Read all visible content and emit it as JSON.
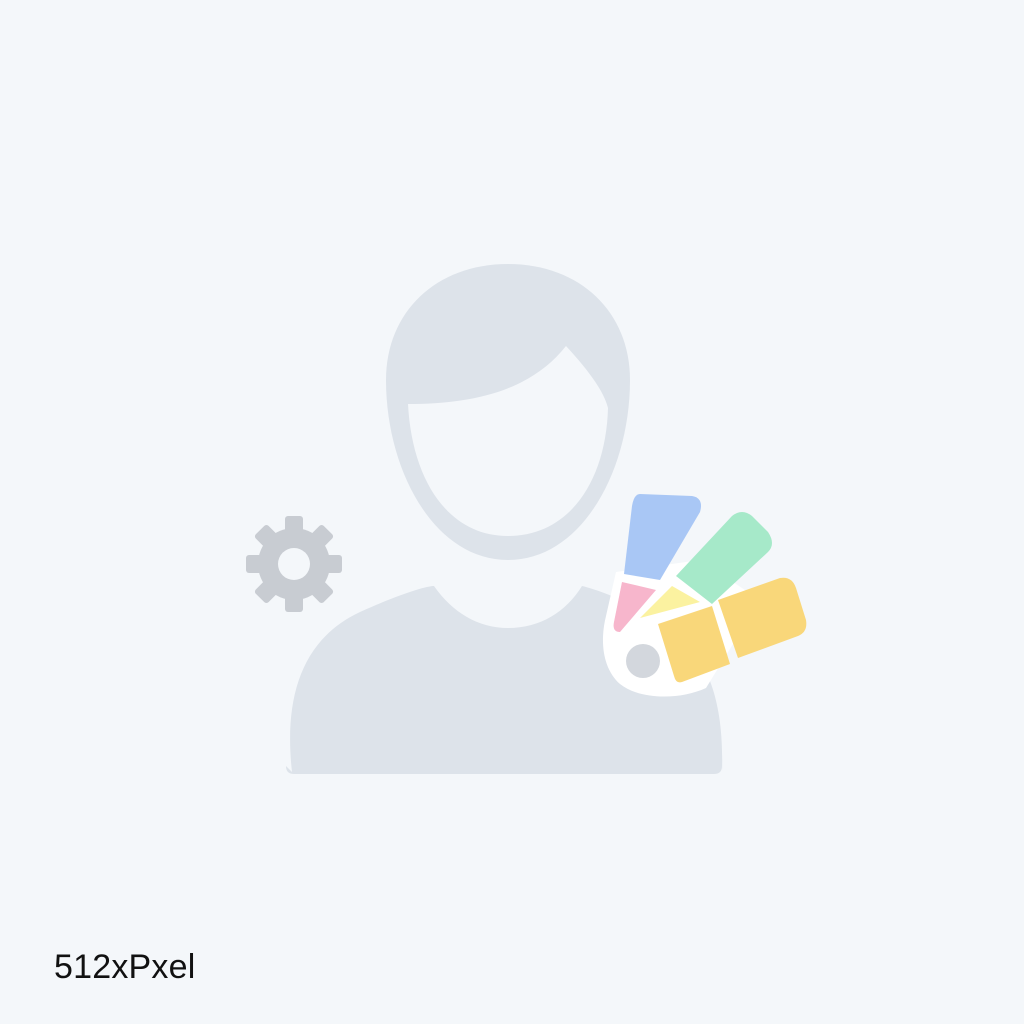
{
  "watermark": {
    "text": "512xPxel"
  },
  "illustration": {
    "subject": "user-avatar-placeholder",
    "icons": [
      "avatar-icon",
      "gear-icon",
      "color-swatch-fan-icon"
    ]
  },
  "colors": {
    "background": "#f4f7fa",
    "avatar": "#dde3ea",
    "gear": "#c8ccd2",
    "swatch_blue": "#a9c7f5",
    "swatch_green": "#a6e9c9",
    "swatch_yellow": "#f9d77a",
    "swatch_pale_yellow": "#fbf2a0",
    "swatch_pink": "#f7b6cc",
    "swatch_pivot": "#d3d7dd"
  }
}
